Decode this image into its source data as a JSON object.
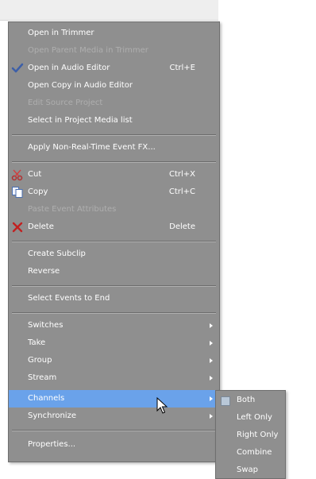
{
  "menu": {
    "items": [
      {
        "label": "Open in Trimmer",
        "shortcut": "",
        "disabled": false
      },
      {
        "label": "Open Parent Media in Trimmer",
        "shortcut": "",
        "disabled": true
      },
      {
        "label": "Open in Audio Editor",
        "shortcut": "Ctrl+E",
        "disabled": false,
        "icon": "checkmark-icon"
      },
      {
        "label": "Open Copy in Audio Editor",
        "shortcut": "",
        "disabled": false
      },
      {
        "label": "Edit Source Project",
        "shortcut": "",
        "disabled": true
      },
      {
        "label": "Select in Project Media list",
        "shortcut": "",
        "disabled": false
      },
      {
        "label": "Apply Non-Real-Time Event FX...",
        "shortcut": "",
        "disabled": false
      },
      {
        "label": "Cut",
        "shortcut": "Ctrl+X",
        "disabled": false,
        "icon": "scissors-icon"
      },
      {
        "label": "Copy",
        "shortcut": "Ctrl+C",
        "disabled": false,
        "icon": "copy-icon"
      },
      {
        "label": "Paste Event Attributes",
        "shortcut": "",
        "disabled": true
      },
      {
        "label": "Delete",
        "shortcut": "Delete",
        "disabled": false,
        "icon": "delete-x-icon"
      },
      {
        "label": "Create Subclip",
        "shortcut": "",
        "disabled": false
      },
      {
        "label": "Reverse",
        "shortcut": "",
        "disabled": false
      },
      {
        "label": "Select Events to End",
        "shortcut": "",
        "disabled": false
      },
      {
        "label": "Switches",
        "submenu": true
      },
      {
        "label": "Take",
        "submenu": true
      },
      {
        "label": "Group",
        "submenu": true
      },
      {
        "label": "Stream",
        "submenu": true
      },
      {
        "label": "Channels",
        "submenu": true,
        "highlighted": true
      },
      {
        "label": "Synchronize",
        "submenu": true
      },
      {
        "label": "Properties...",
        "shortcut": ""
      }
    ]
  },
  "channels_submenu": {
    "items": [
      {
        "label": "Both",
        "checked": true
      },
      {
        "label": "Left Only",
        "checked": false
      },
      {
        "label": "Right Only",
        "checked": false
      },
      {
        "label": "Combine",
        "checked": false
      },
      {
        "label": "Swap",
        "checked": false
      }
    ]
  },
  "colors": {
    "menu_bg": "#8f8f8f",
    "highlight": "#6aa2ea",
    "text": "#ffffff"
  }
}
